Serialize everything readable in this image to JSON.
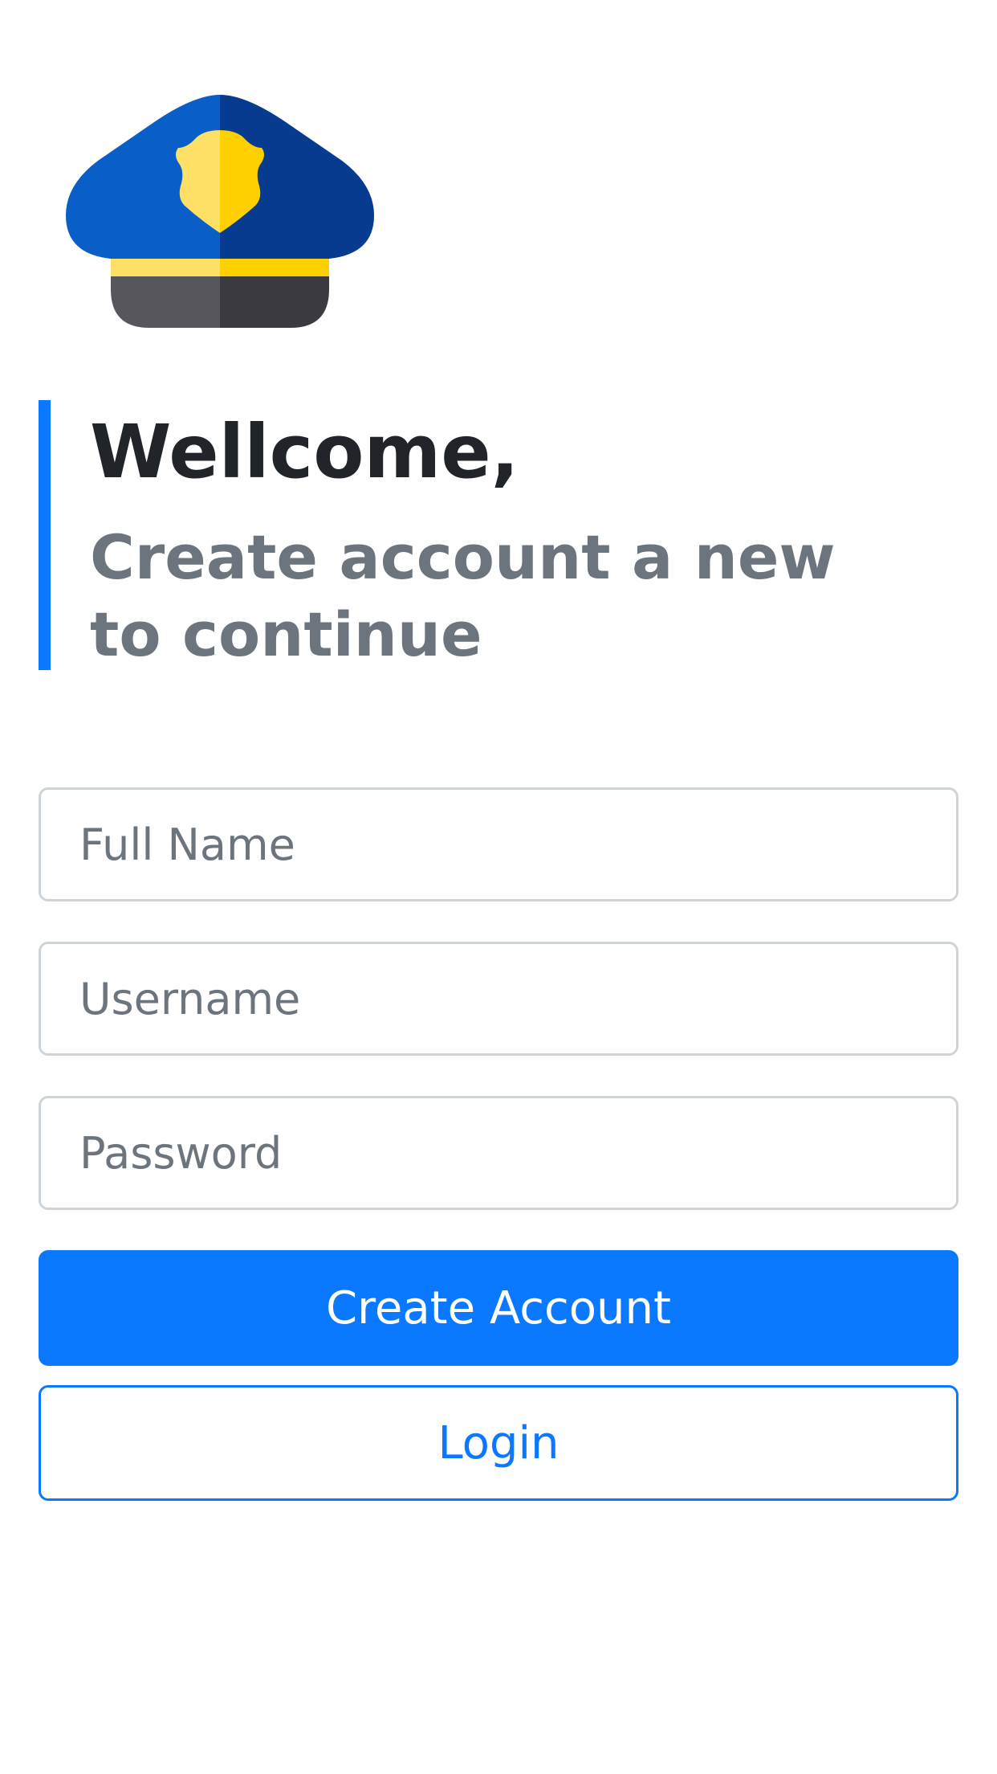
{
  "logo": {
    "icon": "police-cap-icon",
    "colors": {
      "cap_light": "#0a5ec8",
      "cap_dark": "#063b8f",
      "badge_light": "#ffe066",
      "badge_dark": "#ffd000",
      "band_light": "#ffe066",
      "band_dark": "#ffd000",
      "visor_light": "#57565d",
      "visor_dark": "#3b3a40"
    }
  },
  "heading": {
    "title": "Wellcome,",
    "subtitle": "Create account a new to continue"
  },
  "form": {
    "full_name": {
      "placeholder": "Full Name",
      "value": ""
    },
    "username": {
      "placeholder": "Username",
      "value": ""
    },
    "password": {
      "placeholder": "Password",
      "value": ""
    }
  },
  "buttons": {
    "create_account_label": "Create Account",
    "login_label": "Login"
  },
  "colors": {
    "accent": "#0a78ff",
    "title_text": "#212529",
    "muted_text": "#6c757d",
    "border": "#ced4da"
  }
}
